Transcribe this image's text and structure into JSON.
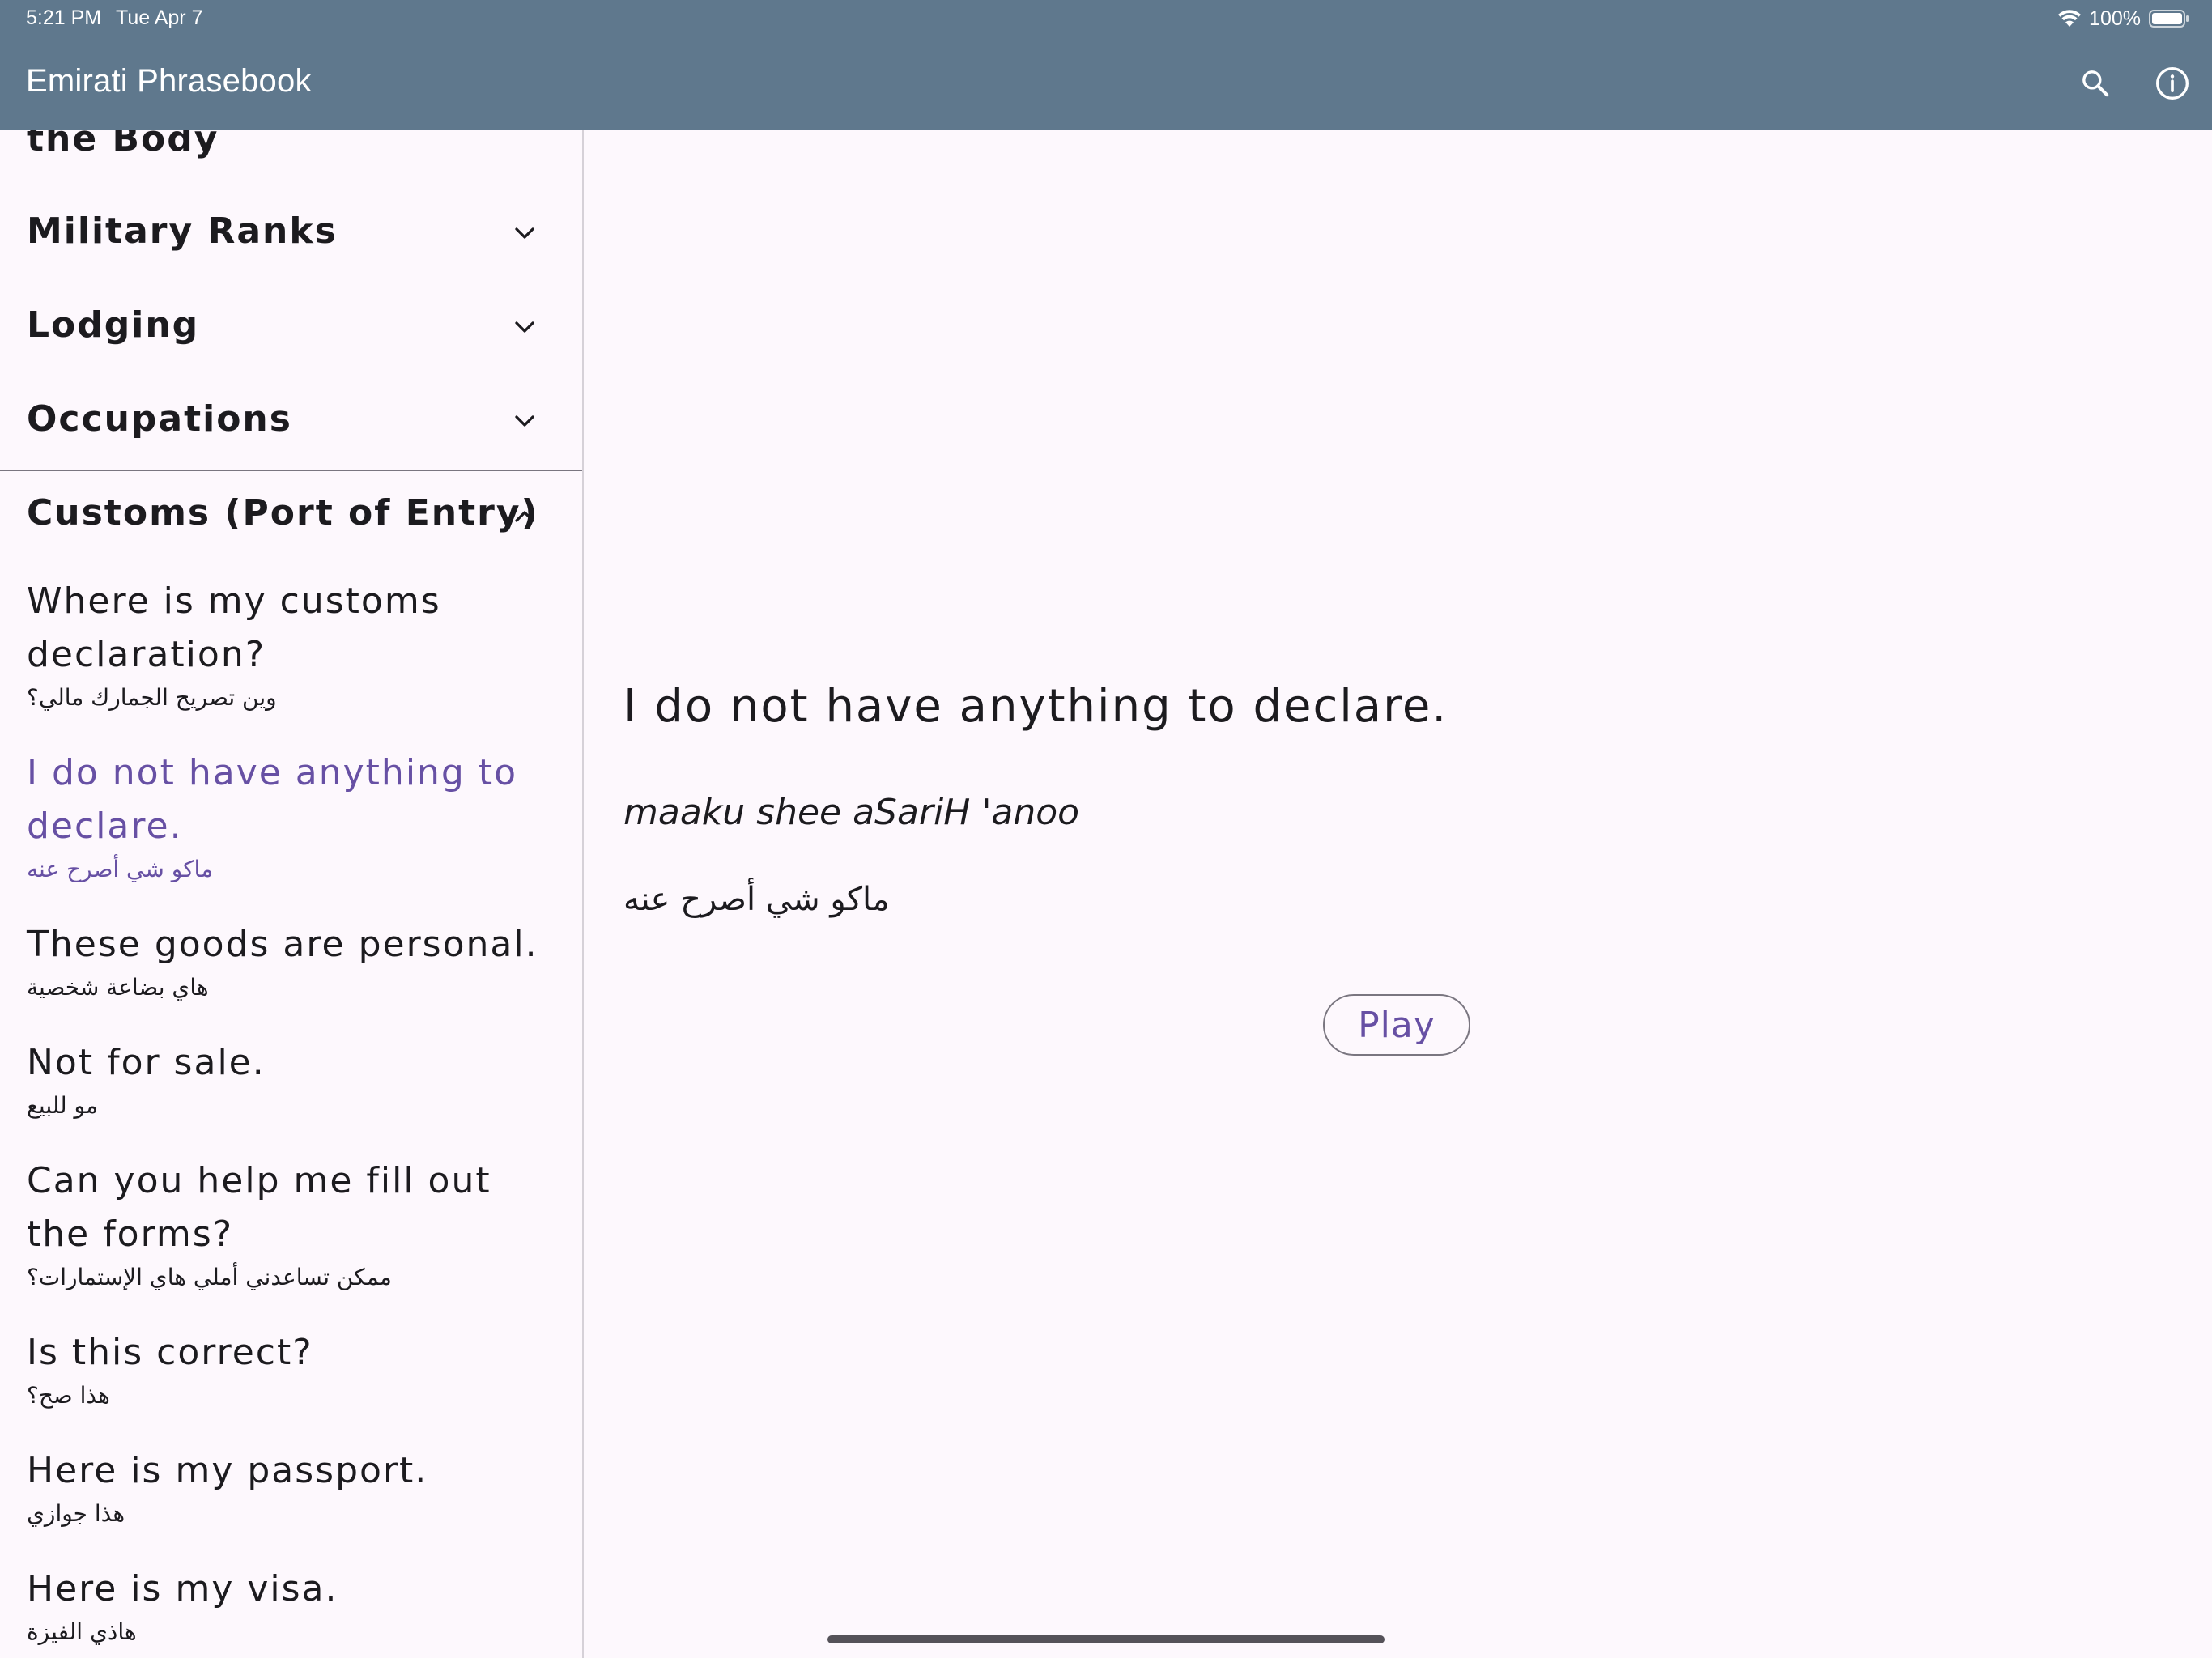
{
  "status_bar": {
    "time": "5:21 PM",
    "date": "Tue Apr 7",
    "battery": "100%"
  },
  "app_bar": {
    "title": "Emirati Phrasebook"
  },
  "sidebar": {
    "partial_category": "the Body",
    "categories": [
      {
        "label": "Military Ranks",
        "state": "collapsed"
      },
      {
        "label": "Lodging",
        "state": "collapsed"
      },
      {
        "label": "Occupations",
        "state": "collapsed"
      },
      {
        "label": "Customs (Port of Entry)",
        "state": "expanded"
      }
    ],
    "phrases": [
      {
        "en": "Where is my customs declaration?",
        "ar": "وين تصريح الجمارك مالي؟"
      },
      {
        "en": "I do not have anything to declare.",
        "ar": "ماكو شي أصرح عنه",
        "selected": true
      },
      {
        "en": "These goods are personal.",
        "ar": "هاي بضاعة شخصية"
      },
      {
        "en": "Not for sale.",
        "ar": "مو للبيع"
      },
      {
        "en": "Can you help me fill out the forms?",
        "ar": "ممكن تساعدني أملي هاي الإستمارات؟"
      },
      {
        "en": "Is this correct?",
        "ar": "هذا صح؟"
      },
      {
        "en": "Here is my passport.",
        "ar": "هذا جوازي"
      },
      {
        "en": "Here is my visa.",
        "ar": "هاذي الفيزة"
      }
    ]
  },
  "detail": {
    "english": "I do not have anything to declare.",
    "transliteration": "maaku shee aSariH 'anoo",
    "arabic": "ماكو شي أصرح عنه",
    "play_label": "Play"
  },
  "colors": {
    "app_bar": "#5f788d",
    "background": "#fdf8fd",
    "accent": "#6750a4",
    "text": "#1c1b1f"
  },
  "icons": {
    "search": "search-icon",
    "info": "info-icon",
    "expand": "chevron-down-icon",
    "collapse": "chevron-up-icon"
  }
}
